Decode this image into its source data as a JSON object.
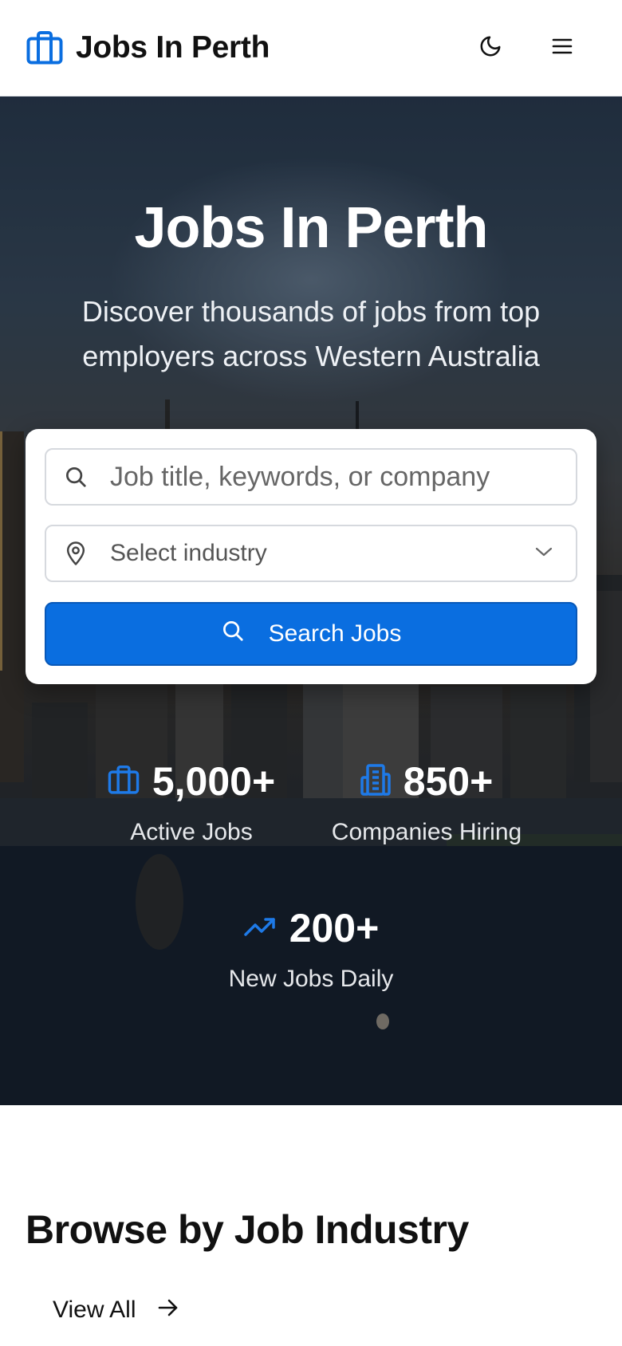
{
  "header": {
    "brand_name": "Jobs In Perth",
    "brand_icon": "briefcase-icon",
    "theme_toggle_icon": "moon-icon",
    "menu_icon": "hamburger-menu-icon"
  },
  "hero": {
    "title": "Jobs In Perth",
    "subtitle": "Discover thousands of jobs from top employers across Western Australia"
  },
  "search": {
    "keyword_placeholder": "Job title, keywords, or company",
    "industry_select_value": "Select industry",
    "button_label": "Search Jobs"
  },
  "stats": [
    {
      "icon": "briefcase-icon",
      "value": "5,000+",
      "label": "Active Jobs"
    },
    {
      "icon": "building-icon",
      "value": "850+",
      "label": "Companies Hiring"
    },
    {
      "icon": "trending-up-icon",
      "value": "200+",
      "label": "New Jobs Daily"
    }
  ],
  "browse": {
    "title": "Browse by Job Industry",
    "view_all_label": "View All"
  },
  "colors": {
    "accent": "#0a6ee0",
    "text_dark": "#111111"
  }
}
